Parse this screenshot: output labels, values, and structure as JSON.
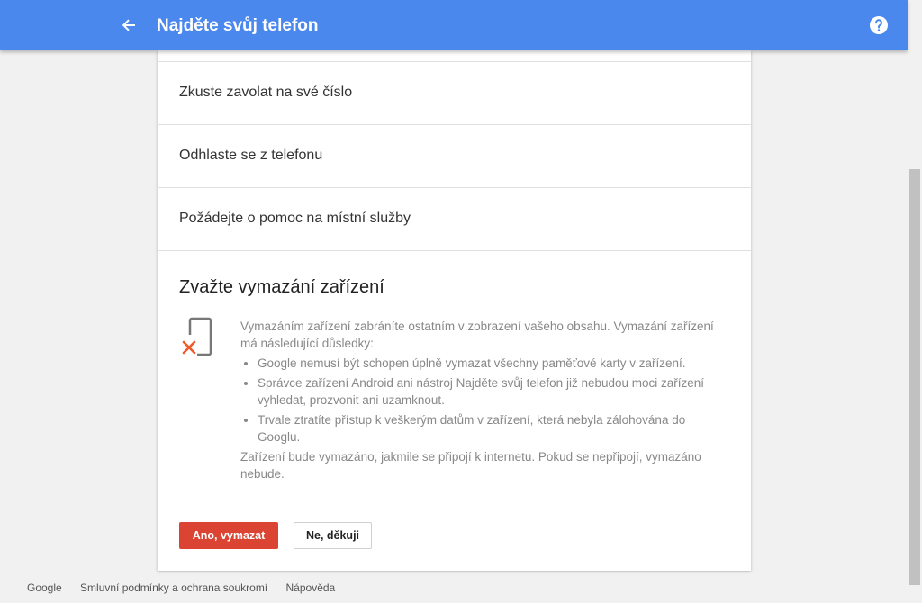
{
  "header": {
    "title": "Najděte svůj telefon",
    "back_icon": "arrow-left-icon",
    "help_icon": "help-circle-icon",
    "bar_color": "#4a88ee"
  },
  "options": [
    {
      "label": "Zkuste zavolat na své číslo"
    },
    {
      "label": "Odhlaste se z telefonu"
    },
    {
      "label": "Požádejte o pomoc na místní služby"
    }
  ],
  "wipe": {
    "title": "Zvažte vymazání zařízení",
    "icon": "phone-erase-icon",
    "intro": "Vymazáním zařízení zabráníte ostatním v zobrazení vašeho obsahu. Vymazání zařízení má následující důsledky:",
    "consequences": [
      "Google nemusí být schopen úplně vymazat všechny paměťové karty v zařízení.",
      "Správce zařízení Android ani nástroj Najděte svůj telefon již nebudou moci zařízení vyhledat, prozvonit ani uzamknout.",
      "Trvale ztratíte přístup k veškerým datům v zařízení, která nebyla zálohována do Googlu."
    ],
    "note": "Zařízení bude vymazáno, jakmile se připojí k internetu. Pokud se nepřipojí, vymazáno nebude.",
    "confirm_label": "Ano, vymazat",
    "cancel_label": "Ne, děkuji",
    "confirm_color": "#db4432"
  },
  "footer": {
    "links": [
      "Google",
      "Smluvní podmínky a ochrana soukromí",
      "Nápověda"
    ]
  }
}
